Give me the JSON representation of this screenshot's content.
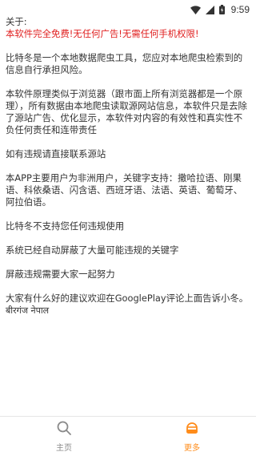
{
  "status_bar": {
    "time": "9:59",
    "icons": [
      "wifi-icon",
      "signal-icon",
      "battery-icon"
    ]
  },
  "about": {
    "title": "关于:",
    "free_notice": "本软件完全免费!无任何广告!无需任何手机权限!",
    "paragraphs": [
      "比特冬是一个本地数据爬虫工具，您应对本地爬虫检索到的信息自行承担风险。",
      "本软件原理类似于浏览器（跟市面上所有浏览器都是一个原理），所有数据由本地爬虫读取源网站信息，本软件只是去除了源站广告、优化显示，本软件对内容的有效性和真实性不负任何责任和连带责任",
      "如有违规请直接联系源站",
      "本APP主要用户为非洲用户，关键字支持：撒哈拉语、刚果语、科依桑语、闪含语、西班牙语、法语、英语、葡萄牙、阿拉伯语。",
      "比特冬不支持您任何违规使用",
      "系统已经自动屏蔽了大量可能违规的关键字",
      "屏蔽违规需要大家一起努力",
      "大家有什么好的建议欢迎在GooglePlay评论上面告诉小冬。"
    ],
    "signature": "बीरगंज नेपाल"
  },
  "bottom_nav": {
    "items": [
      {
        "label": "主页",
        "icon": "search-icon",
        "active": false
      },
      {
        "label": "更多",
        "icon": "more-profile-icon",
        "active": true
      }
    ],
    "active_color": "#ff8c1a",
    "inactive_color": "#8a8a8a"
  }
}
